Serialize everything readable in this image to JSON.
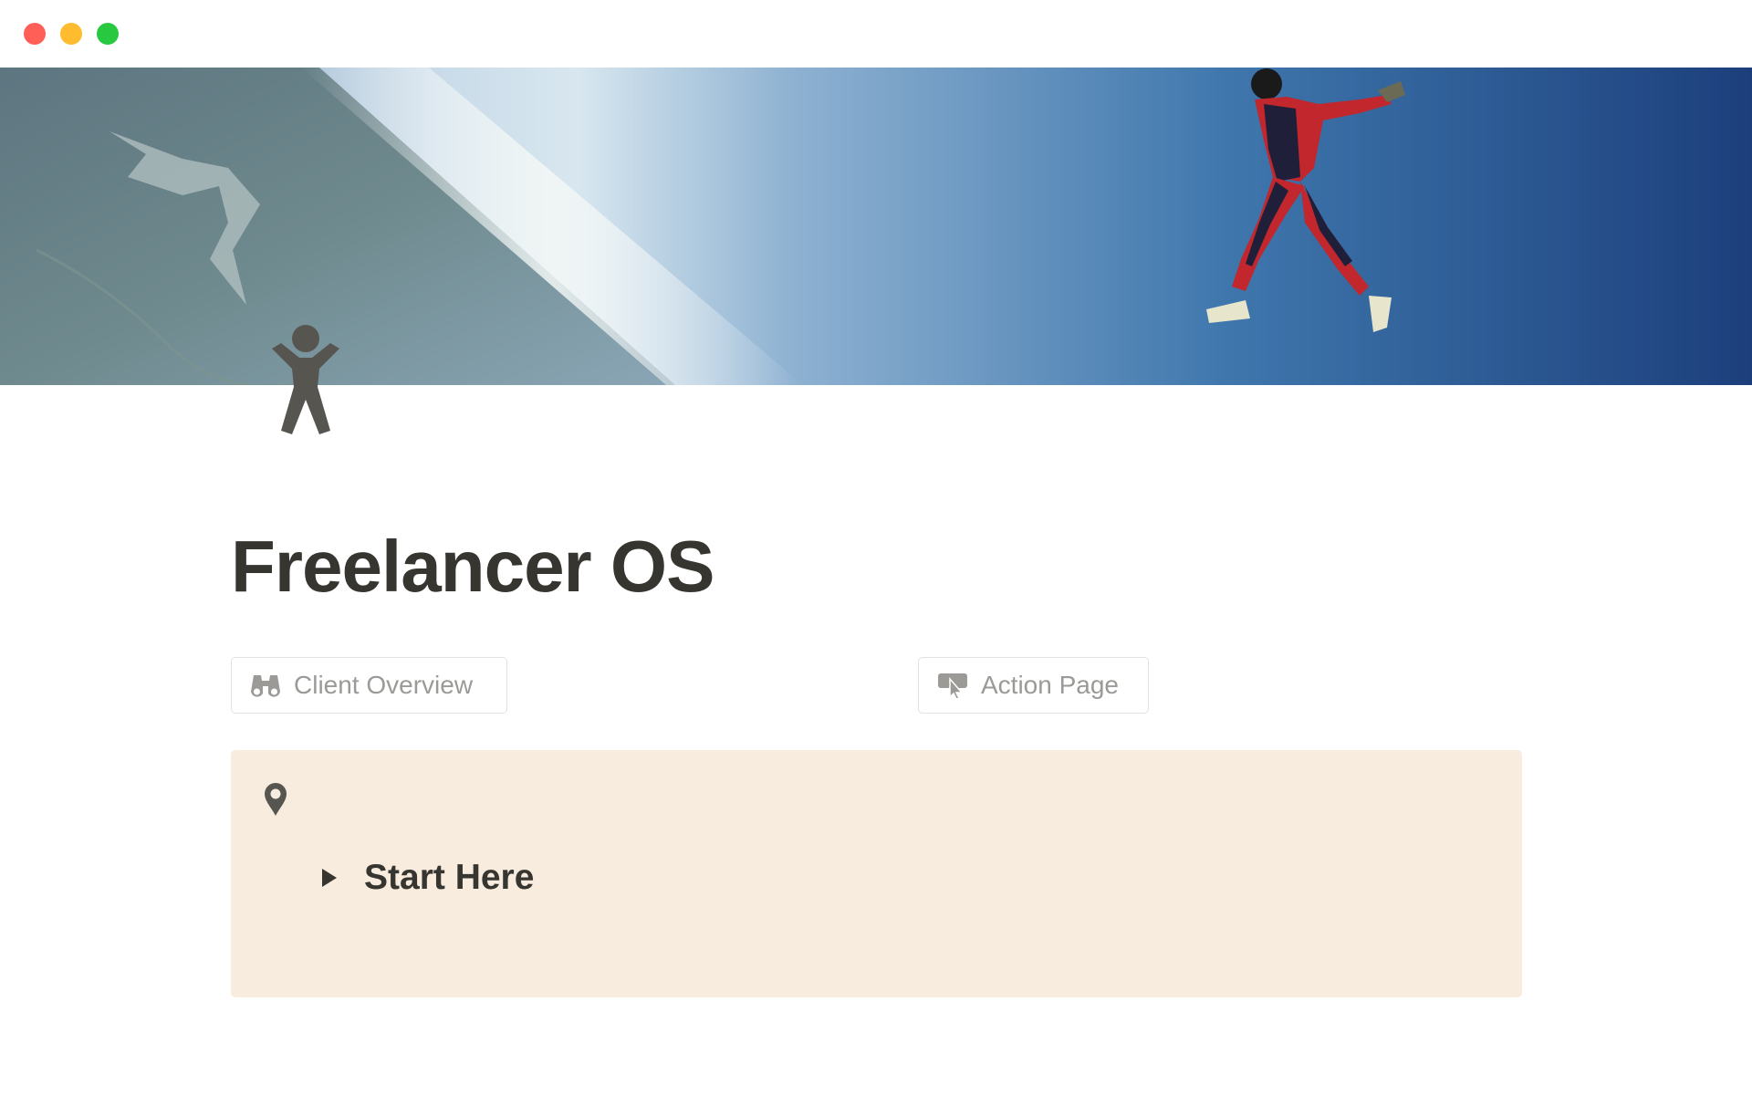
{
  "window": {
    "traffic_lights": {
      "close_color": "#ff5f57",
      "minimize_color": "#febc2e",
      "maximize_color": "#28c840"
    }
  },
  "cover": {
    "image": "skydiver-in-blue-sky-over-earth"
  },
  "page": {
    "icon": "person-standing-icon",
    "title": "Freelancer OS"
  },
  "links": [
    {
      "label": "Client Overview",
      "icon": "binoculars-icon"
    },
    {
      "label": "Action Page",
      "icon": "pointer-click-icon"
    }
  ],
  "callout": {
    "icon": "map-pin-icon",
    "background": "#f8ecdf",
    "toggle": {
      "label": "Start Here",
      "expanded": false
    }
  }
}
